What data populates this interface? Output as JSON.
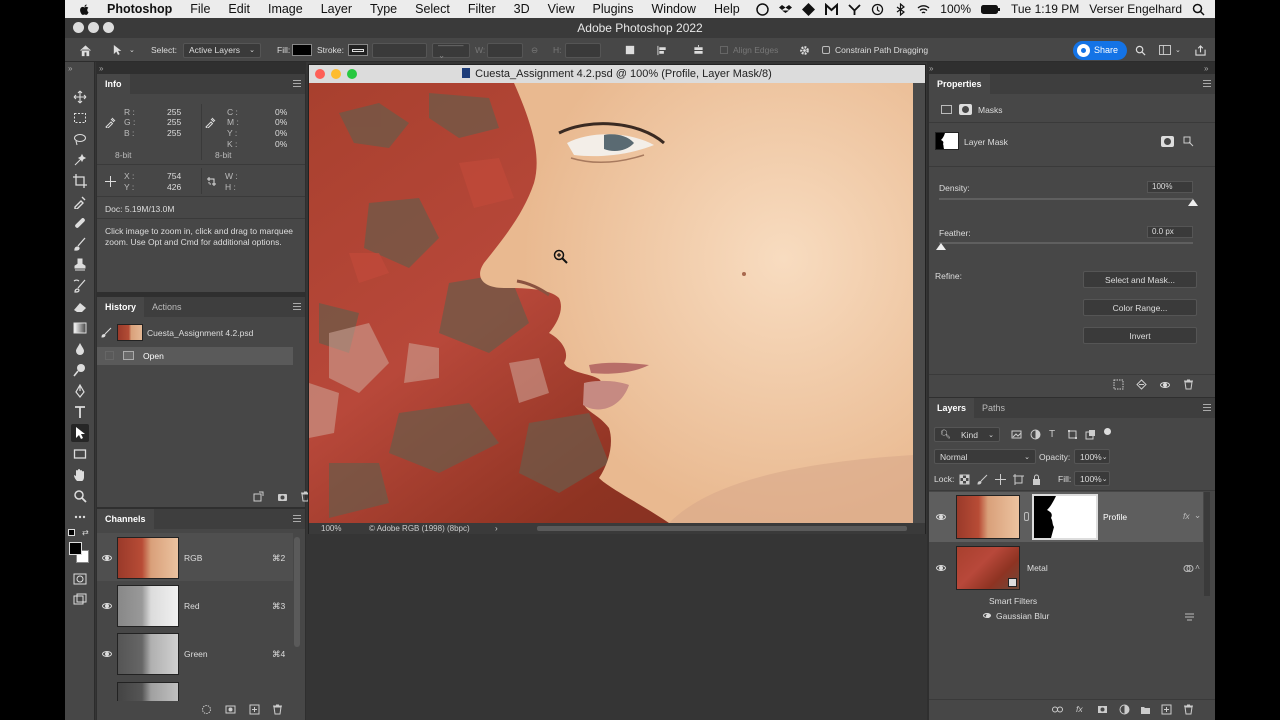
{
  "menubar": {
    "app_name": "Photoshop",
    "items": [
      "File",
      "Edit",
      "Image",
      "Layer",
      "Type",
      "Select",
      "Filter",
      "3D",
      "View",
      "Plugins",
      "Help",
      "Window"
    ],
    "battery": "100%",
    "clock": "Tue 1:19 PM",
    "user": "Verser Engelhard"
  },
  "window": {
    "title": "Adobe Photoshop 2022"
  },
  "options_bar": {
    "select_label": "Select:",
    "select_value": "Active Layers",
    "fill_label": "Fill:",
    "stroke_label": "Stroke:",
    "w_label": "W:",
    "h_label": "H:",
    "align_edges": "Align Edges",
    "constrain": "Constrain Path Dragging",
    "share_label": "Share"
  },
  "info_panel": {
    "tab": "Info",
    "r_label": "R :",
    "r_value": "255",
    "g_label": "G :",
    "g_value": "255",
    "b_label": "B :",
    "b_value": "255",
    "c_label": "C :",
    "c_value": "0%",
    "m_label": "M :",
    "m_value": "0%",
    "y_label": "Y :",
    "y_value": "0%",
    "k_label": "K :",
    "k_value": "0%",
    "bit_left": "8-bit",
    "bit_right": "8-bit",
    "x_label": "X :",
    "x_value": "754",
    "ycoord_label": "Y :",
    "ycoord_value": "426",
    "w_label": "W :",
    "h_label": "H :",
    "doc": "Doc: 5.19M/13.0M",
    "hint": "Click image to zoom in, click and drag to marquee zoom.  Use Opt and Cmd for additional options."
  },
  "history_panel": {
    "tab_history": "History",
    "tab_actions": "Actions",
    "snapshot": "Cuesta_Assignment 4.2.psd",
    "step": "Open"
  },
  "channels_panel": {
    "tab": "Channels",
    "channels": [
      {
        "name": "RGB",
        "shortcut": "⌘2"
      },
      {
        "name": "Red",
        "shortcut": "⌘3"
      },
      {
        "name": "Green",
        "shortcut": "⌘4"
      }
    ]
  },
  "document": {
    "title": "Cuesta_Assignment 4.2.psd @ 100% (Profile, Layer Mask/8)",
    "zoom": "100%",
    "profile": "Adobe RGB (1998) (8bpc)"
  },
  "properties_panel": {
    "tab": "Properties",
    "section": "Masks",
    "mask_label": "Layer Mask",
    "density_label": "Density:",
    "density_value": "100%",
    "density_level": 1.0,
    "feather_label": "Feather:",
    "feather_value": "0.0 px",
    "feather_level": 0.0,
    "refine_label": "Refine:",
    "btn_select_mask": "Select and Mask...",
    "btn_color_range": "Color Range...",
    "btn_invert": "Invert"
  },
  "layers_panel": {
    "tab_layers": "Layers",
    "tab_paths": "Paths",
    "kind": "Kind",
    "blend": "Normal",
    "opacity_label": "Opacity:",
    "opacity_value": "100%",
    "lock_label": "Lock:",
    "fill_label": "Fill:",
    "fill_value": "100%",
    "layers": [
      {
        "name": "Profile"
      },
      {
        "name": "Metal"
      }
    ],
    "smart_filters": "Smart Filters",
    "filter": "Gaussian Blur"
  },
  "colors": {
    "ps_bg": "#353535",
    "panel": "#474747",
    "accent": "#1473e6"
  }
}
